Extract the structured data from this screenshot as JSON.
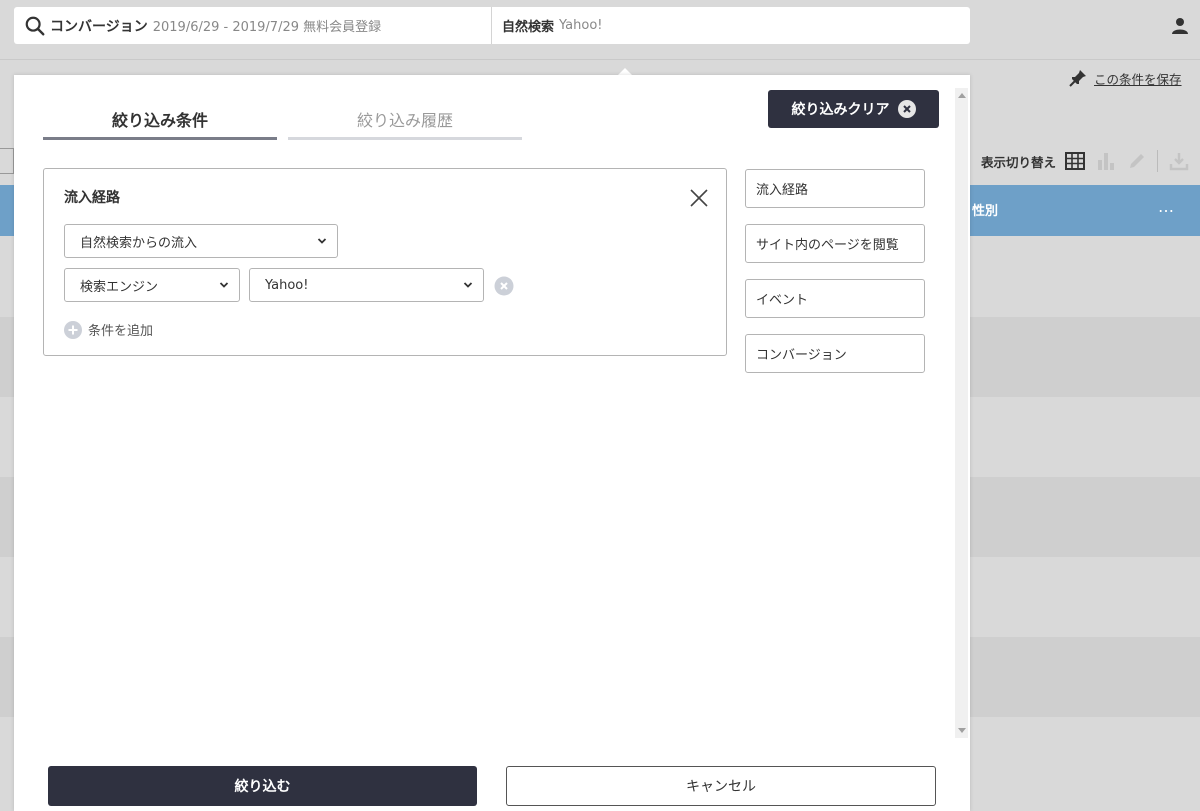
{
  "topbar": {
    "title": "コンバージョン",
    "subtitle": "2019/6/29 - 2019/7/29 無料会員登録",
    "filter_label": "自然検索",
    "filter_value": "Yahoo!"
  },
  "background": {
    "save_condition_label": "この条件を保存",
    "view_switch_label": "表示切り替え",
    "column_header": "性別",
    "column_menu": "…"
  },
  "modal": {
    "tabs": [
      {
        "label": "絞り込み条件",
        "active": true
      },
      {
        "label": "絞り込み履歴",
        "active": false
      }
    ],
    "clear_button": "絞り込みクリア",
    "condition": {
      "title": "流入経路",
      "select_source": "自然検索からの流入",
      "select_key": "検索エンジン",
      "select_value": "Yahoo!",
      "add_condition": "条件を追加"
    },
    "side_buttons": [
      {
        "label": "流入経路"
      },
      {
        "label": "サイト内のページを閲覧"
      },
      {
        "label": "イベント"
      },
      {
        "label": "コンバージョン"
      }
    ],
    "apply_button": "絞り込む",
    "cancel_button": "キャンセル"
  },
  "colors": {
    "dark_button": "#2f3140",
    "table_header": "#6ea0c8",
    "overlay_background": "#d9d9d9"
  }
}
